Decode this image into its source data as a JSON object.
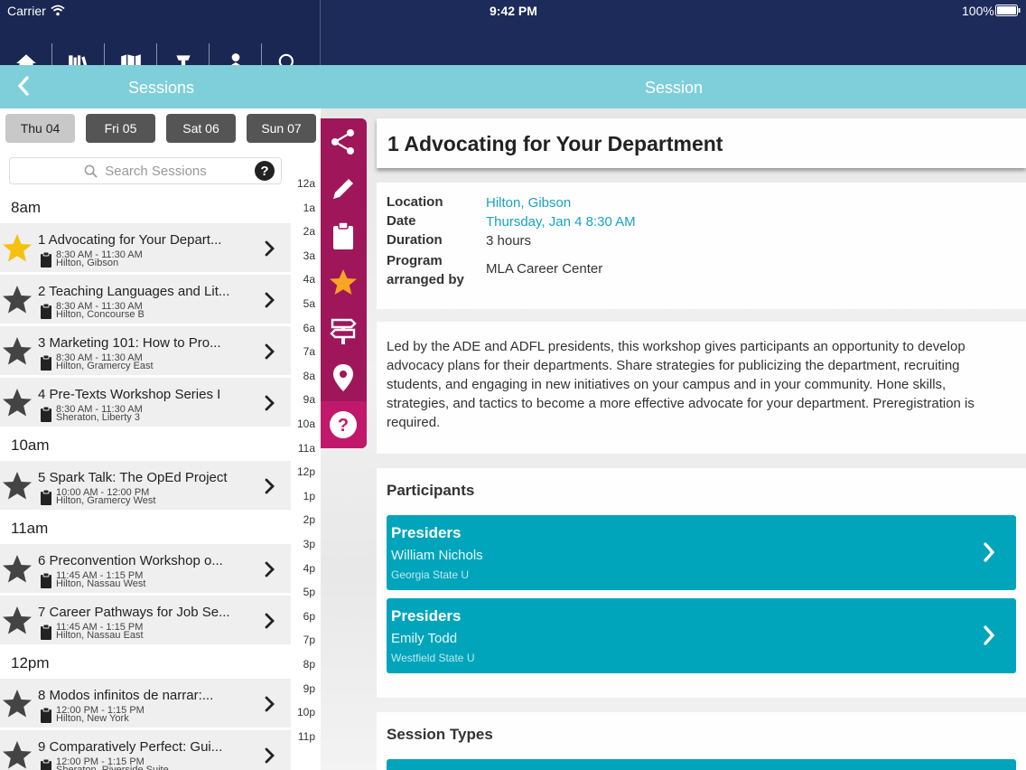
{
  "status_bar": {
    "carrier": "Carrier",
    "time": "9:42 PM",
    "battery": "100%"
  },
  "nav_icons": [
    "home-icon",
    "library-icon",
    "map-icon",
    "podium-icon",
    "person-icon",
    "search-icon"
  ],
  "left_header": {
    "title": "Sessions",
    "back_icon": "chevron-left-icon"
  },
  "right_header": {
    "title": "Session"
  },
  "days": [
    {
      "label": "Thu 04",
      "selected": true
    },
    {
      "label": "Fri 05",
      "selected": false
    },
    {
      "label": "Sat 06",
      "selected": false
    },
    {
      "label": "Sun 07",
      "selected": false
    }
  ],
  "search": {
    "placeholder": "Search Sessions",
    "help": "?"
  },
  "hour_index": [
    "12a",
    "1a",
    "2a",
    "3a",
    "4a",
    "5a",
    "6a",
    "7a",
    "8a",
    "9a",
    "10a",
    "11a",
    "12p",
    "1p",
    "2p",
    "3p",
    "4p",
    "5p",
    "6p",
    "7p",
    "8p",
    "9p",
    "10p",
    "11p"
  ],
  "groups": [
    {
      "hour": "8am",
      "sessions": [
        {
          "title": "1 Advocating for Your Depart...",
          "time": "8:30 AM - 11:30 AM",
          "room": "Hilton, Gibson",
          "starred": true
        },
        {
          "title": "2 Teaching Languages and Lit...",
          "time": "8:30 AM - 11:30 AM",
          "room": "Hilton, Concourse B",
          "starred": false
        },
        {
          "title": "3 Marketing 101: How to Pro...",
          "time": "8:30 AM - 11:30 AM",
          "room": "Hilton, Gramercy East",
          "starred": false
        },
        {
          "title": "4 Pre-Texts Workshop Series I",
          "time": "8:30 AM - 11:30 AM",
          "room": "Sheraton, Liberty 3",
          "starred": false
        }
      ]
    },
    {
      "hour": "10am",
      "sessions": [
        {
          "title": "5 Spark Talk: The OpEd Project",
          "time": "10:00 AM - 12:00 PM",
          "room": "Hilton, Gramercy West",
          "starred": false
        }
      ]
    },
    {
      "hour": "11am",
      "sessions": [
        {
          "title": "6 Preconvention Workshop o...",
          "time": "11:45 AM - 1:15 PM",
          "room": "Hilton, Nassau West",
          "starred": false
        },
        {
          "title": "7 Career Pathways for Job Se...",
          "time": "11:45 AM - 1:15 PM",
          "room": "Hilton, Nassau East",
          "starred": false
        }
      ]
    },
    {
      "hour": "12pm",
      "sessions": [
        {
          "title": "8 Modos infinitos de narrar:...",
          "time": "12:00 PM - 1:15 PM",
          "room": "Hilton, New York",
          "starred": false
        },
        {
          "title": "9 Comparatively Perfect: Gui...",
          "time": "12:00 PM - 1:15 PM",
          "room": "Sheraton, Riverside Suite",
          "starred": false
        }
      ]
    }
  ],
  "toolbar_icons": [
    "share-icon",
    "pencil-icon",
    "clipboard-icon",
    "star-icon",
    "signpost-icon",
    "location-pin-icon",
    "help-icon"
  ],
  "detail": {
    "title": "1 Advocating for Your Department",
    "fields": [
      {
        "label": "Location",
        "value": "Hilton, Gibson",
        "link": true
      },
      {
        "label": "Date",
        "value": "Thursday, Jan 4 8:30 AM",
        "link": true
      },
      {
        "label": "Duration",
        "value": "3 hours",
        "link": false
      },
      {
        "label": "Program arranged by",
        "value": "MLA Career Center",
        "link": false
      }
    ],
    "description": "Led by the ADE and ADFL presidents, this workshop gives participants an opportunity to develop advocacy plans for their departments. Share strategies for publicizing the department, recruiting students, and engaging in new initiatives on your campus and in your community. Hone skills, strategies, and tactics to become a more effective advocate for your department. Preregistration is required.",
    "participants_heading": "Participants",
    "participants": [
      {
        "role": "Presiders",
        "name": "William Nichols",
        "affiliation": "Georgia State U"
      },
      {
        "role": "Presiders",
        "name": "Emily Todd",
        "affiliation": "Westfield State U"
      }
    ],
    "session_types_heading": "Session Types"
  },
  "colors": {
    "nav": "#1d2b5b",
    "subheader": "#7fcfdb",
    "toolbar": "#a0165a",
    "accent": "#00a5bb",
    "star_active": "#f5c10f",
    "star_inactive": "#444444"
  }
}
